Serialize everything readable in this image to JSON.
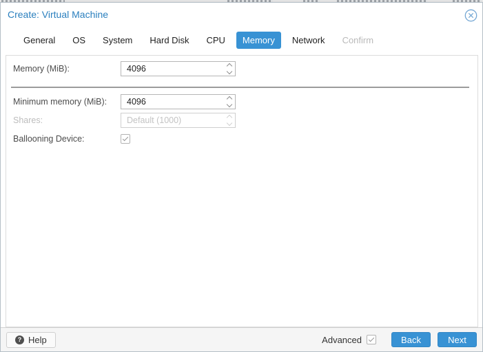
{
  "window": {
    "title": "Create: Virtual Machine"
  },
  "tabs": [
    {
      "label": "General"
    },
    {
      "label": "OS"
    },
    {
      "label": "System"
    },
    {
      "label": "Hard Disk"
    },
    {
      "label": "CPU"
    },
    {
      "label": "Memory"
    },
    {
      "label": "Network"
    },
    {
      "label": "Confirm"
    }
  ],
  "active_tab": "Memory",
  "disabled_tab": "Confirm",
  "form": {
    "memory": {
      "label": "Memory (MiB):",
      "value": "4096"
    },
    "min_memory": {
      "label": "Minimum memory (MiB):",
      "value": "4096"
    },
    "shares": {
      "label": "Shares:",
      "value": "Default (1000)",
      "enabled": false
    },
    "ballooning": {
      "label": "Ballooning Device:",
      "checked": true
    }
  },
  "footer": {
    "help": "Help",
    "advanced": "Advanced",
    "advanced_checked": true,
    "back": "Back",
    "next": "Next"
  },
  "colors": {
    "accent": "#3892d4",
    "title_blue": "#2a7fbe",
    "close_blue": "#74a7d4",
    "disabled_text": "#c3c3c3",
    "footer_bg": "#f5f5f5"
  }
}
